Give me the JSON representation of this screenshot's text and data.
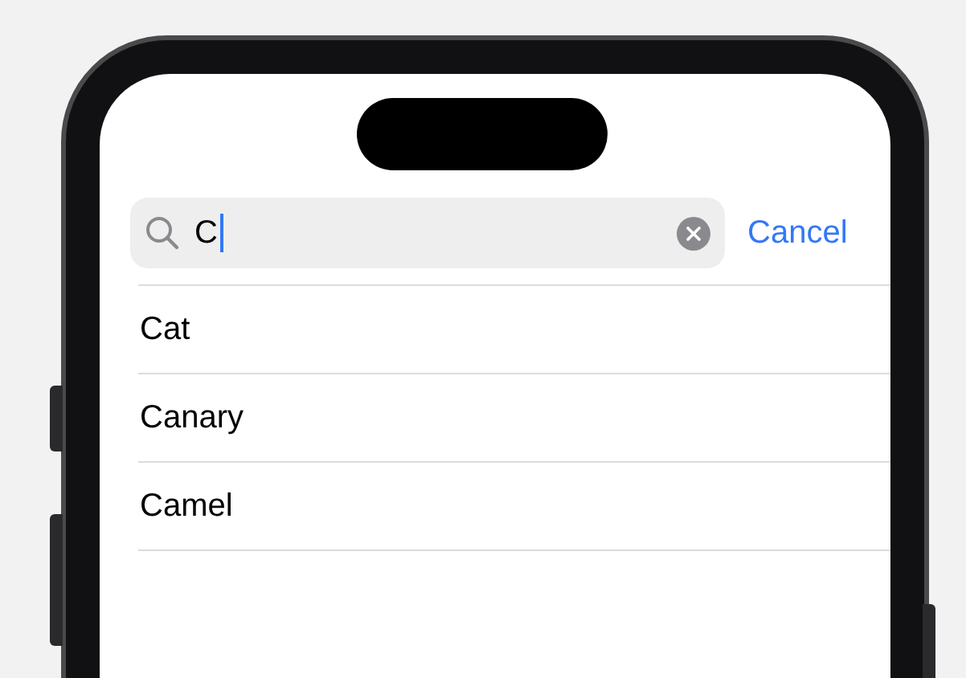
{
  "search": {
    "value": "C"
  },
  "cancel_button": "Cancel",
  "results": [
    {
      "label": "Cat"
    },
    {
      "label": "Canary"
    },
    {
      "label": "Camel"
    }
  ]
}
